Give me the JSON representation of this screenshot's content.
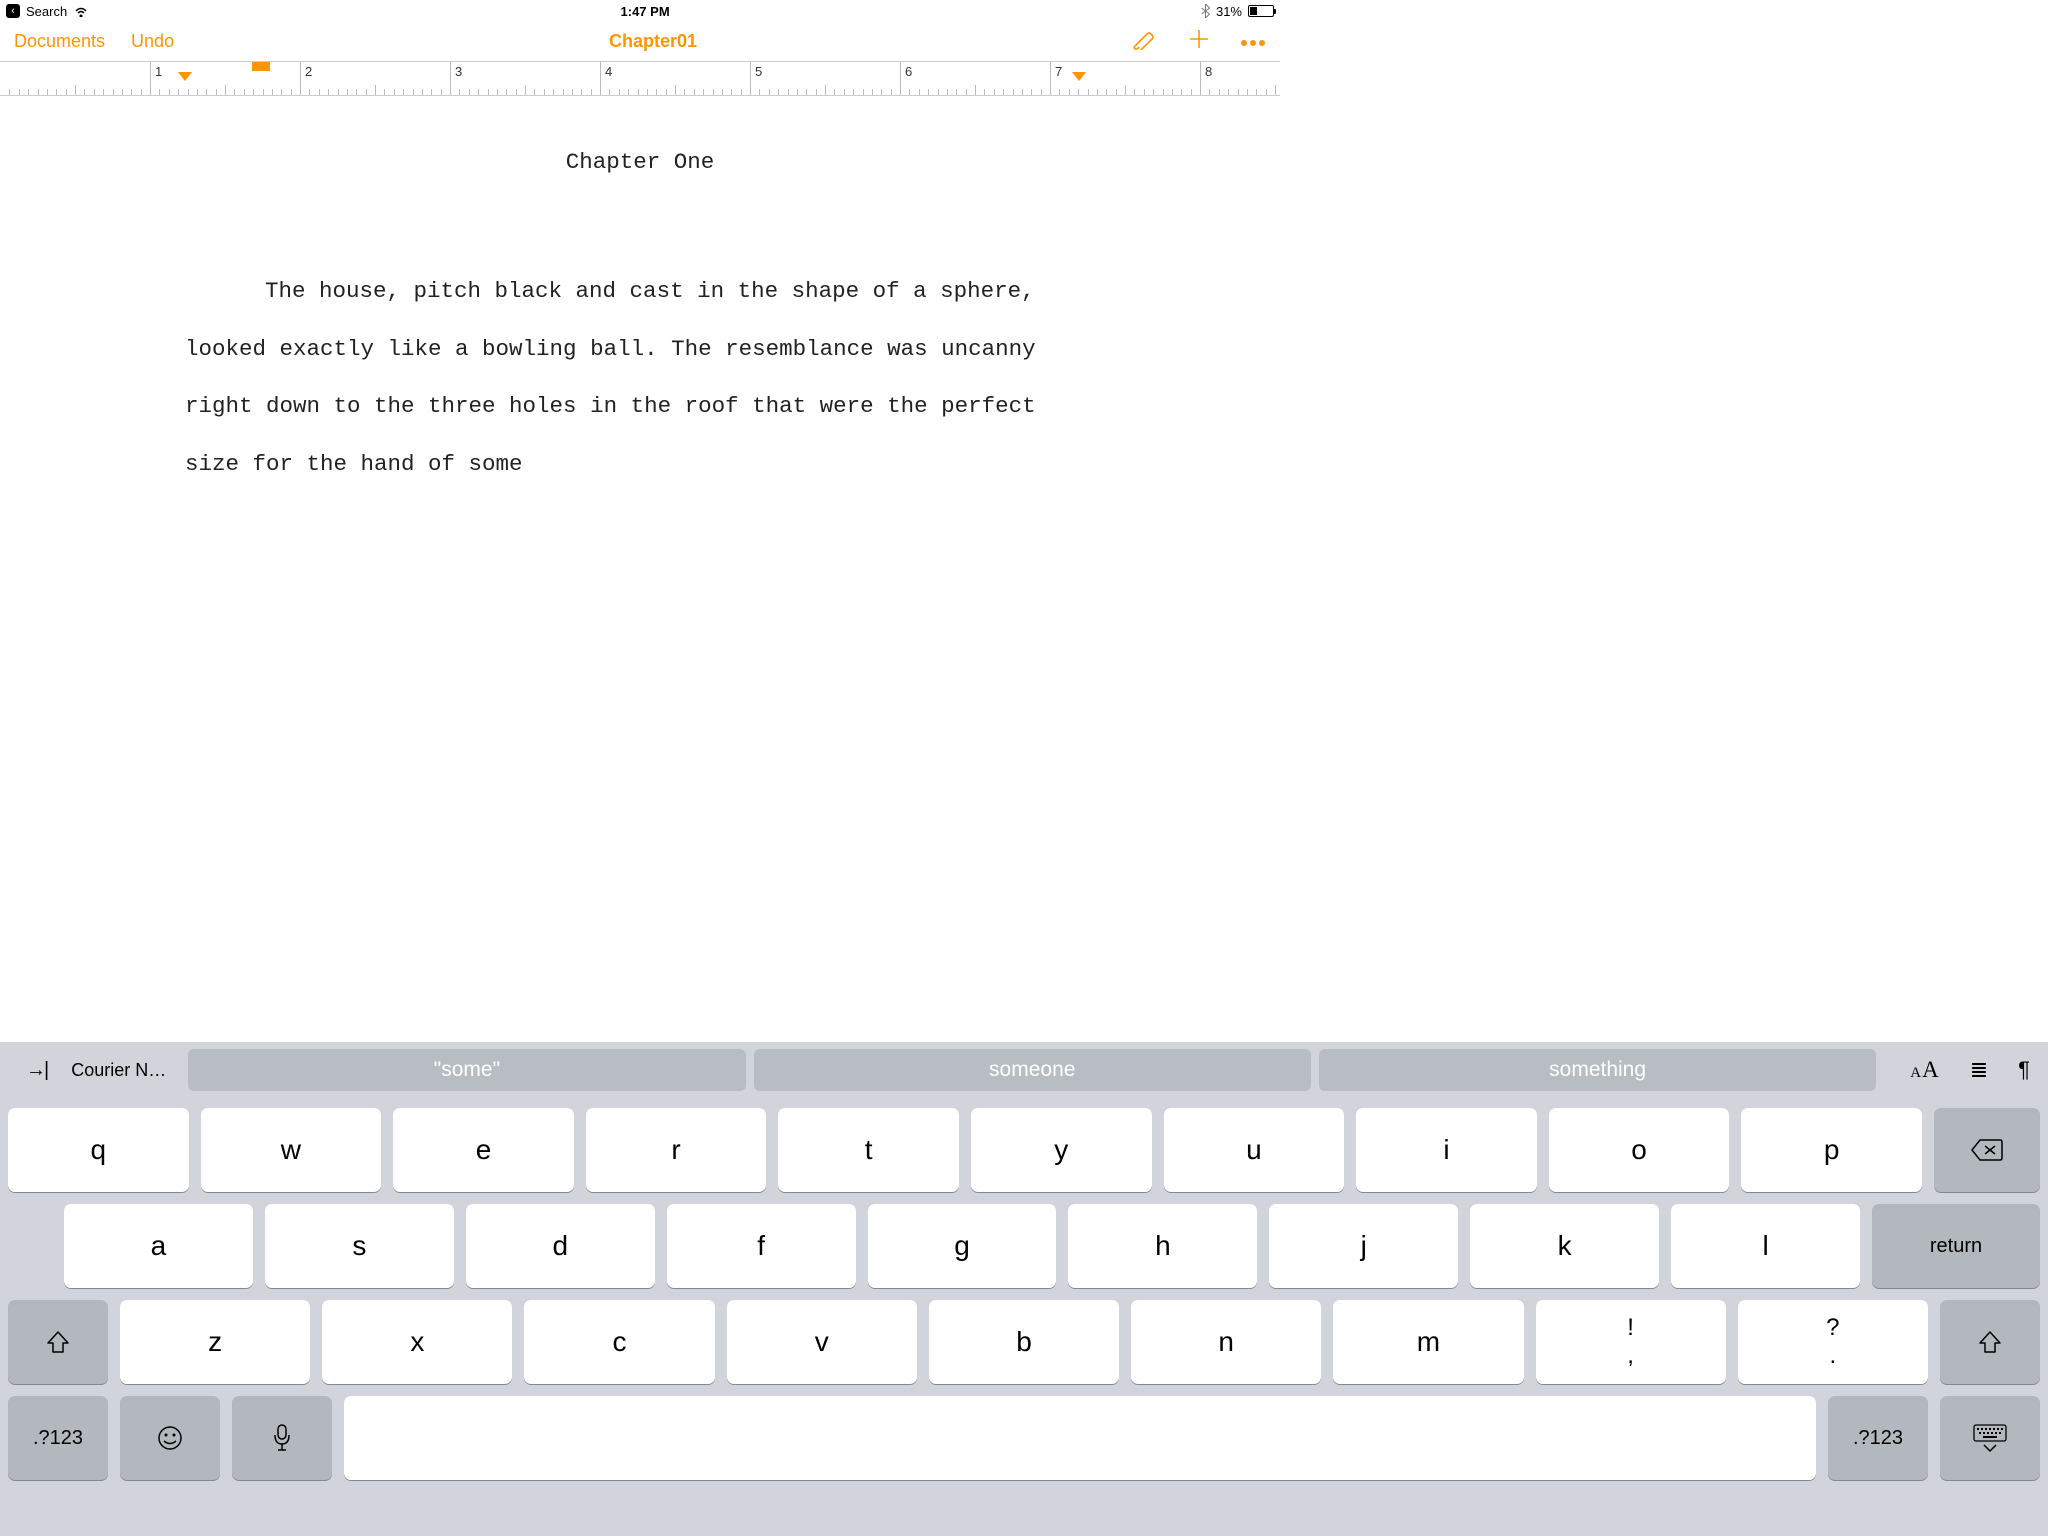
{
  "status": {
    "back_label": "Search",
    "time": "1:47 PM",
    "battery_pct": "31%"
  },
  "toolbar": {
    "documents": "Documents",
    "undo": "Undo",
    "title": "Chapter01"
  },
  "ruler": {
    "labels": [
      "1",
      "2",
      "3",
      "4",
      "5",
      "6",
      "7",
      "8"
    ]
  },
  "doc": {
    "heading": "Chapter One",
    "body": "The house, pitch black and cast in the shape of a sphere, looked exactly like a bowling ball.  The resemblance was uncanny right down to the three holes in the roof that were the perfect size for the hand of some"
  },
  "kb": {
    "font": "Courier N…",
    "suggestions": [
      "\"some\"",
      "someone",
      "something"
    ],
    "row1": [
      "q",
      "w",
      "e",
      "r",
      "t",
      "y",
      "u",
      "i",
      "o",
      "p"
    ],
    "row2": [
      "a",
      "s",
      "d",
      "f",
      "g",
      "h",
      "j",
      "k",
      "l"
    ],
    "row3": [
      "z",
      "x",
      "c",
      "v",
      "b",
      "n",
      "m"
    ],
    "punct1_top": "!",
    "punct1_bot": ",",
    "punct2_top": "?",
    "punct2_bot": ".",
    "return": "return",
    "numswitch": ".?123"
  }
}
